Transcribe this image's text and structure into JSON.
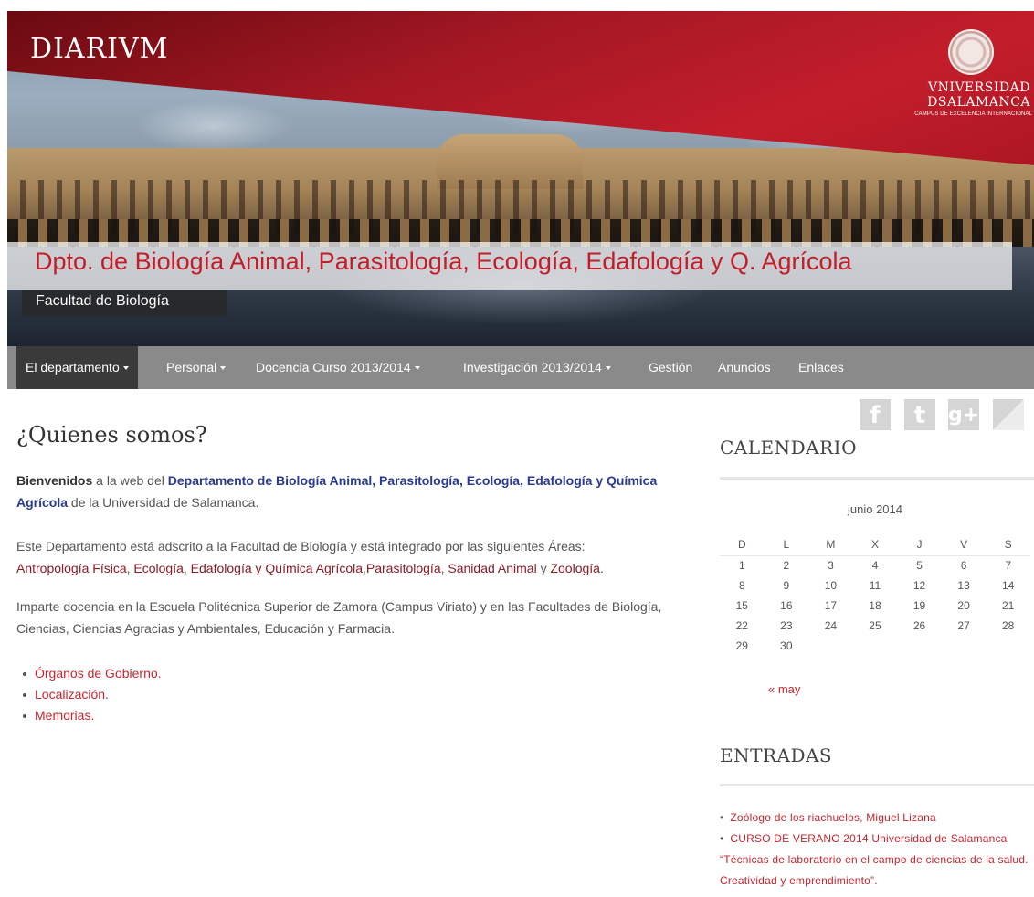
{
  "header": {
    "logo": "DIARIVM",
    "university_line1": "VNIVERSIDAD",
    "university_line2": "DSALAMANCA",
    "university_tagline": "CAMPUS DE EXCELENCIA INTERNACIONAL",
    "department_title": "Dpto. de Biología Animal, Parasitología, Ecología, Edafología y Q. Agrícola",
    "faculty": "Facultad de Biología"
  },
  "nav": {
    "items": [
      {
        "label": "El departamento",
        "dropdown": true,
        "active": true
      },
      {
        "label": "Personal",
        "dropdown": true
      },
      {
        "label": "Docencia Curso 2013/2014",
        "dropdown": true
      },
      {
        "label": "Investigación 2013/2014",
        "dropdown": true
      },
      {
        "label": "Gestión",
        "dropdown": false
      },
      {
        "label": "Anuncios",
        "dropdown": false
      },
      {
        "label": "Enlaces",
        "dropdown": false
      }
    ]
  },
  "social": {
    "facebook": "f",
    "twitter": "t",
    "googleplus": "g+",
    "rss": ""
  },
  "main": {
    "title": "¿Quienes somos?",
    "p1": {
      "welcome": "Bienvenidos",
      "text1": " a la web del ",
      "dept_link": "Departamento de Biología Animal, Parasitología, Ecología, Edafología y Química Agrícola",
      "text2": " de la Universidad de Salamanca."
    },
    "p2": {
      "intro": "Este Departamento está adscrito a la Facultad de Biología y está integrado por las siguientes Áreas:",
      "area1": "Antropología Física",
      "sep1": ", ",
      "area2": "Ecología",
      "sep2": ", ",
      "area3": "Edafología y Química Agrícola",
      "sep3": ",",
      "area4": "Parasitología",
      "sep4": ", ",
      "area5": "Sanidad Animal",
      "sep5": " y ",
      "area6": "Zoología",
      "end": "."
    },
    "p3": "Imparte docencia en la Escuela Politécnica Superior de Zamora (Campus Viriato) y en las Facultades de Biología, Ciencias, Ciencias Agracias y Ambientales, Educación y Farmacia.",
    "links": [
      "Órganos de Gobierno.",
      "Localización.",
      "Memorias."
    ]
  },
  "sidebar": {
    "calendar_heading": "CALENDARIO",
    "calendar": {
      "caption": "junio 2014",
      "weekdays": [
        "D",
        "L",
        "M",
        "X",
        "J",
        "V",
        "S"
      ],
      "weeks": [
        [
          "1",
          "2",
          "3",
          "4",
          "5",
          "6",
          "7"
        ],
        [
          "8",
          "9",
          "10",
          "11",
          "12",
          "13",
          "14"
        ],
        [
          "15",
          "16",
          "17",
          "18",
          "19",
          "20",
          "21"
        ],
        [
          "22",
          "23",
          "24",
          "25",
          "26",
          "27",
          "28"
        ],
        [
          "29",
          "30",
          "",
          "",
          "",
          "",
          ""
        ]
      ],
      "prev_link": "« may"
    },
    "entries_heading": "ENTRADAS",
    "entries": [
      "Zoólogo de los riachuelos, Miguel Lizana",
      "CURSO DE VERANO 2014 Universidad de Salamanca “Técnicas de laboratorio en el campo de ciencias de la salud. Creatividad y emprendimiento”."
    ]
  }
}
